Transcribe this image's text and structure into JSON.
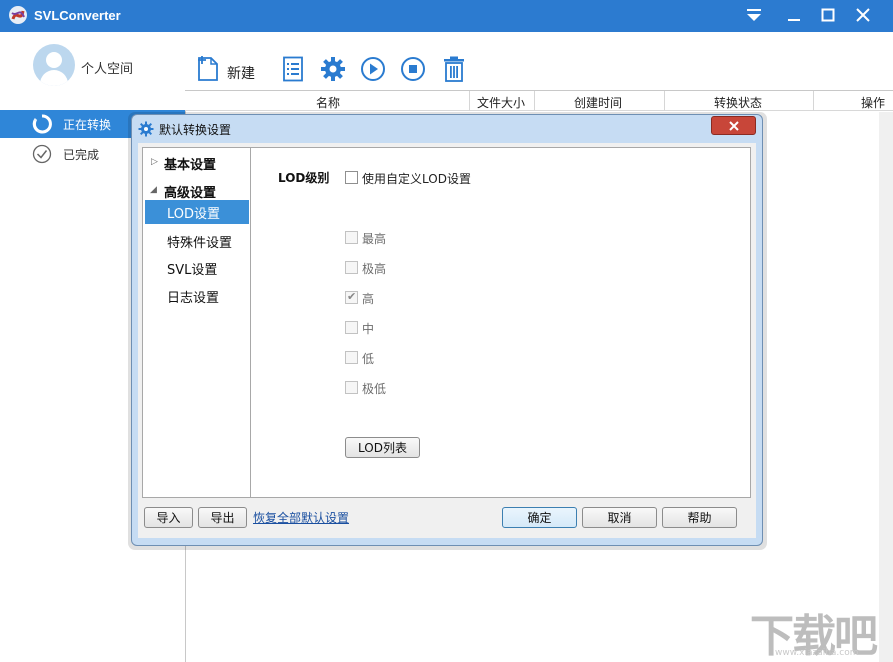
{
  "window": {
    "title": "SVLConverter",
    "accent_color": "#2c7bd0"
  },
  "sidebar": {
    "user_label": "个人空间",
    "items": [
      {
        "label": "正在转换",
        "icon": "refresh-icon",
        "active": true
      },
      {
        "label": "已完成",
        "icon": "check-circle-icon",
        "active": false
      }
    ]
  },
  "toolbar": {
    "new_label": "新建",
    "icons": [
      "add-file-icon",
      "list-icon",
      "gear-icon",
      "play-icon",
      "stop-icon",
      "trash-icon"
    ]
  },
  "table": {
    "columns": [
      "名称",
      "文件大小",
      "创建时间",
      "转换状态",
      "操作"
    ]
  },
  "dialog": {
    "title": "默认转换设置",
    "tree": {
      "basic": "基本设置",
      "advanced": "高级设置",
      "children": [
        "LOD设置",
        "特殊件设置",
        "SVL设置",
        "日志设置"
      ],
      "selected": "LOD设置"
    },
    "lod": {
      "section_label": "LOD级别",
      "custom_checkbox_label": "使用自定义LOD设置",
      "custom_checked": false,
      "levels": [
        {
          "label": "最高",
          "checked": false
        },
        {
          "label": "极高",
          "checked": false
        },
        {
          "label": "高",
          "checked": true
        },
        {
          "label": "中",
          "checked": false
        },
        {
          "label": "低",
          "checked": false
        },
        {
          "label": "极低",
          "checked": false
        }
      ],
      "list_button": "LOD列表"
    },
    "footer": {
      "import": "导入",
      "export": "导出",
      "restore_link": "恢复全部默认设置",
      "ok": "确定",
      "cancel": "取消",
      "help": "帮助"
    }
  },
  "watermark": {
    "text": "下载吧",
    "url": "www.xiazaiba.com"
  }
}
